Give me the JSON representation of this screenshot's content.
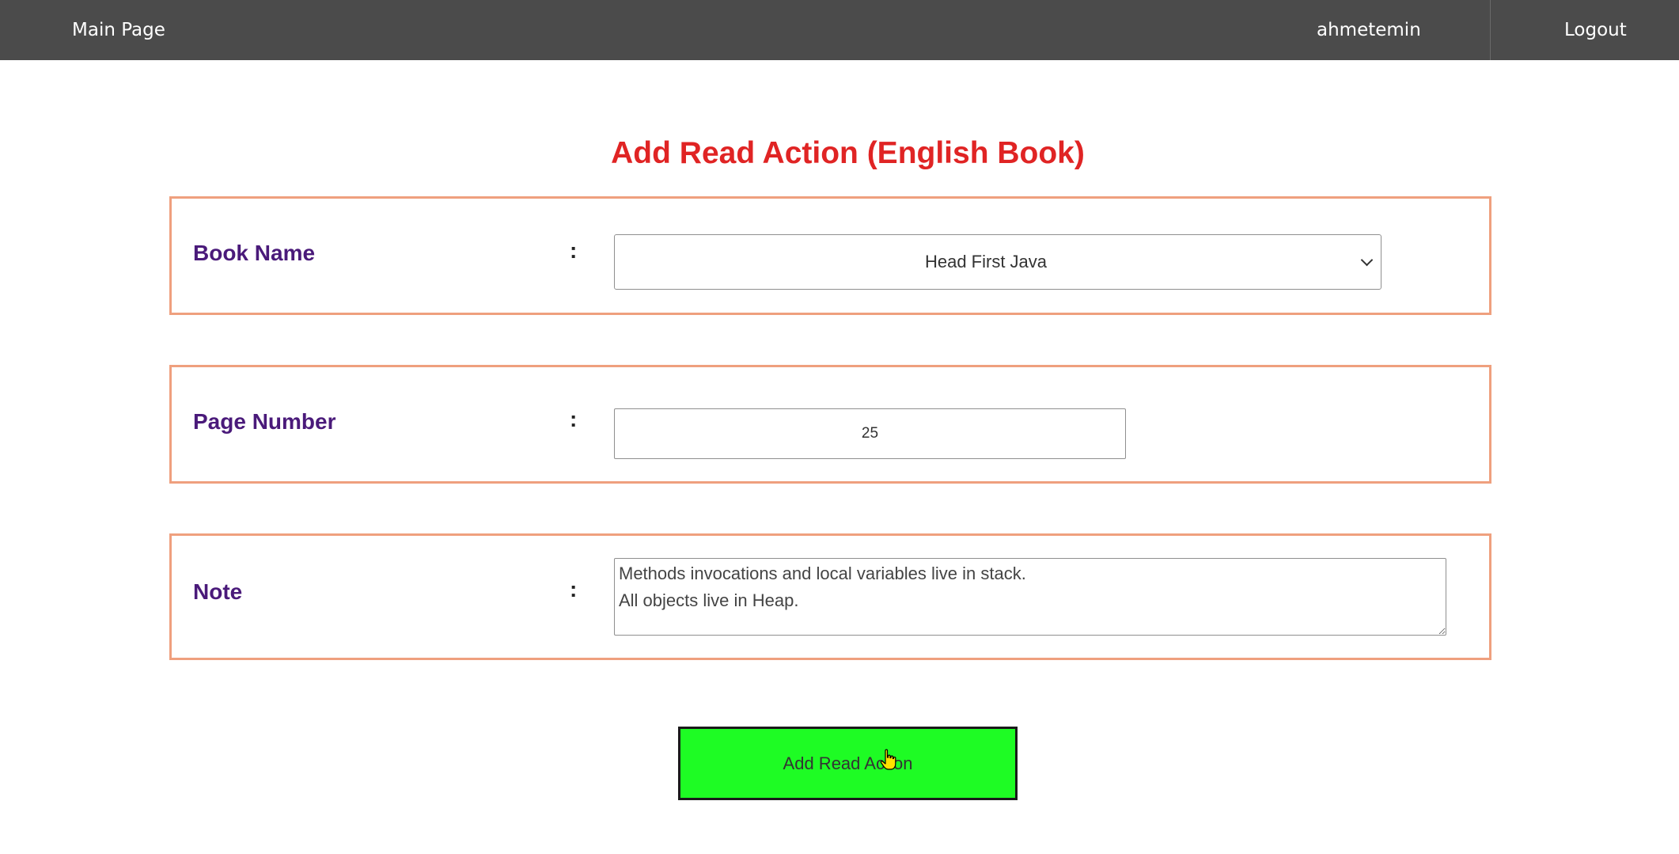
{
  "nav": {
    "main_page": "Main Page",
    "username": "ahmetemin",
    "logout": "Logout"
  },
  "title": "Add Read Action (English Book)",
  "form": {
    "book_name": {
      "label": "Book Name",
      "separator": ":",
      "selected": "Head First Java"
    },
    "page_number": {
      "label": "Page Number",
      "separator": ":",
      "value": "25"
    },
    "note": {
      "label": "Note",
      "separator": ":",
      "value": "Methods invocations and local variables live in stack.\nAll objects live in Heap."
    },
    "submit_label": "Add Read Action"
  },
  "colors": {
    "topbar": "#4b4b4b",
    "title": "#e02424",
    "label": "#4a1a7a",
    "row_border": "#efa07e",
    "submit_bg": "#1efc24"
  },
  "icons": {
    "select_chevron": "chevron-down-icon",
    "mouse_cursor": "hand-pointer-icon"
  }
}
